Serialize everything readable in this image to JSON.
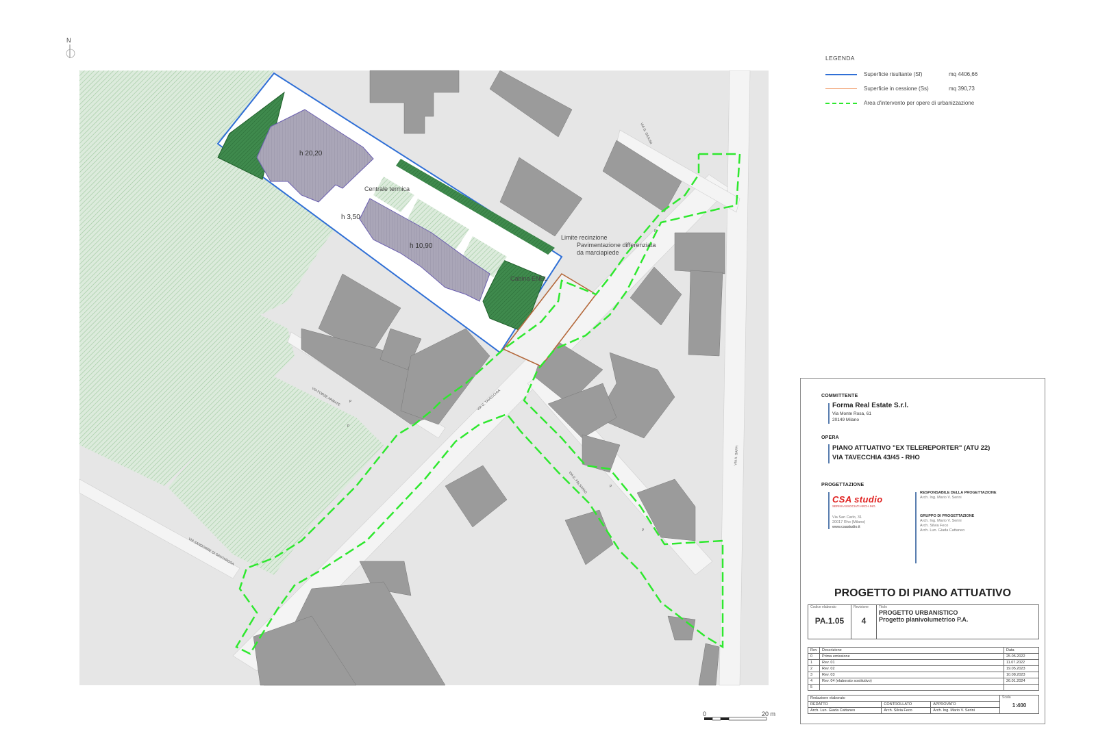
{
  "compass": {
    "north_label": "N"
  },
  "legend": {
    "title": "LEGENDA",
    "items": [
      {
        "name": "Superficie risultante (Sf)",
        "value": "mq 4406,66",
        "color": "#2f6fd6",
        "style": "solid"
      },
      {
        "name": "Superficie in cessione (Ss)",
        "value": "mq   390,73",
        "color": "#f2a77a",
        "style": "solid"
      },
      {
        "name": "Area d'intervento per opere di urbanizzazione",
        "value": "",
        "color": "#2ee82e",
        "style": "dashed"
      }
    ]
  },
  "map": {
    "height_labels": [
      "h 20,20",
      "h 3,50",
      "h 10,90"
    ],
    "annotations": [
      "Centrale termica",
      "Limite recinzione",
      "Pavimentazione differenziata",
      "da marciapiede",
      "Cabina ENEL"
    ],
    "streets": [
      "VIA G. GIULINI",
      "VIA G. TAVECCHIA",
      "VIA FORZE ARMATE",
      "VIA SANDORRE DI SANTAROSA",
      "VIA E. FALSARIO",
      "VIA A. SAFFI"
    ],
    "parking_mark": "P",
    "scale_bar": {
      "start": "0",
      "end": "20 m"
    },
    "colors": {
      "building": "#9b9b9b",
      "project_building": "#a9a4b6",
      "green": "#c9e1c9",
      "dark_green": "#2f7a3c",
      "lot_outline": "#2f6fd6",
      "cession_outline": "#b4683a",
      "intervention_outline": "#2ee82e",
      "background_area": "#e8e8e8"
    }
  },
  "title_block": {
    "committente_label": "COMMITTENTE",
    "committente_name": "Forma Real Estate S.r.l.",
    "committente_addr1": "Via Monte Rosa, 61",
    "committente_addr2": "20149 Milano",
    "opera_label": "OPERA",
    "opera_line1": "PIANO ATTUATIVO \"EX TELEREPORTER\" (ATU 22)",
    "opera_line2": "VIA TAVECCHIA 43/45 - RHO",
    "progettazione_label": "PROGETTAZIONE",
    "logo_text": "CSA studio",
    "logo_sub": "SERINI ASSOCIATI ARCH.ING.",
    "studio_addr": [
      "Via San Carlo, 31",
      "20017 Rho (Milano)",
      "www.csastudio.it"
    ],
    "responsabile_label": "RESPONSABILE DELLA PROGETTAZIONE",
    "responsabile_name": "Arch. Ing. Mario V. Serini",
    "gruppo_label": "GRUPPO DI PROGETTAZIONE",
    "gruppo_names": [
      "Arch. Ing. Mario V. Serini",
      "Arch. Silvia Feco",
      "Arch. Lun. Giada Cattaneo"
    ],
    "main_title": "PROGETTO DI PIANO ATTUATIVO",
    "codice_label": "Codice elaborato",
    "codice": "PA.1.05",
    "revisione_label": "Revisione",
    "revisione": "4",
    "titolo_label": "Titolo",
    "titolo_line1": "PROGETTO URBANISTICO",
    "titolo_line2": "Progetto planivolumetrico P.A.",
    "rev_header": [
      "Rev",
      "Descrizione",
      "Data"
    ],
    "revisions": [
      [
        "0",
        "Prima emissione",
        "25.05.2022"
      ],
      [
        "1",
        "Rev. 01",
        "11.07.2022"
      ],
      [
        "2",
        "Rev. 02",
        "19.05.2023"
      ],
      [
        "3",
        "Rev. 03",
        "10.08.2023"
      ],
      [
        "4",
        "Rev. 04 (elaborato sostitutivo)",
        "26.01.2024"
      ],
      [
        "5",
        "",
        ""
      ]
    ],
    "redazione_label": "Redazione elaborato",
    "redatto_label": "REDATTO",
    "redatto": "Arch. Lun. Giada Cattaneo",
    "controllato_label": "CONTROLLATO",
    "controllato": "Arch. Silvia Feco",
    "approvato_label": "APPROVATO",
    "approvato": "Arch. Ing. Mario V. Serini",
    "scala_label": "Scala",
    "scala": "1:400"
  }
}
